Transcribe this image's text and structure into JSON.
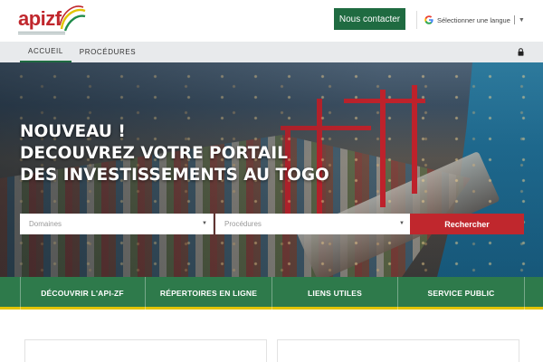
{
  "header": {
    "logo_text": "apizf",
    "contact_label": "Nous contacter",
    "language_label": "Sélectionner une langue"
  },
  "nav": {
    "items": [
      {
        "label": "ACCUEIL",
        "active": true
      },
      {
        "label": "PROCÉDURES",
        "active": false
      }
    ]
  },
  "hero": {
    "title_lines": [
      "NOUVEAU !",
      "DECOUVREZ VOTRE PORTAIL",
      "DES INVESTISSEMENTS AU TOGO"
    ]
  },
  "search": {
    "domaines_placeholder": "Domaines",
    "procedures_placeholder": "Procédures",
    "button_label": "Rechercher"
  },
  "quicklinks": [
    {
      "label": "DÉCOUVRIR L'API-ZF"
    },
    {
      "label": "RÉPERTOIRES EN LIGNE"
    },
    {
      "label": "LIENS UTILES"
    },
    {
      "label": "SERVICE PUBLIC"
    }
  ],
  "colors": {
    "brand_green": "#1f6b41",
    "bar_green": "#2e7a4b",
    "accent_red": "#c0272d",
    "accent_yellow": "#e3c400"
  },
  "icons": {
    "google": "google-g-icon",
    "lock": "lock-icon",
    "caret": "caret-down-icon"
  }
}
